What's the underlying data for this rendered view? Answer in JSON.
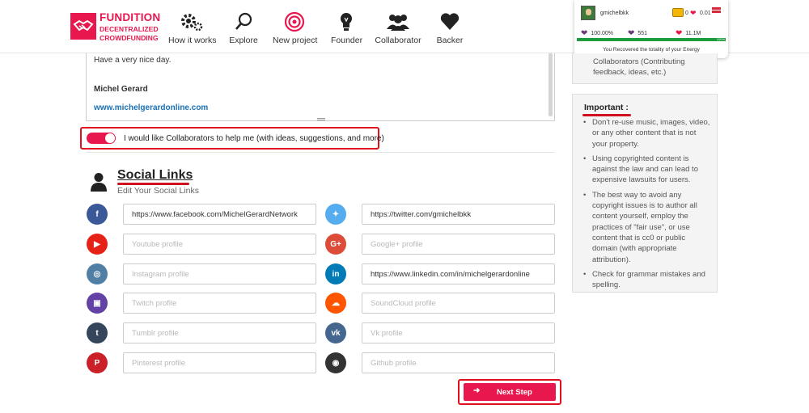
{
  "brand": {
    "name": "FUNDITION",
    "tagline_line1": "DECENTRALIZED",
    "tagline_line2": "CROWDFUNDING",
    "color": "#e8184e"
  },
  "nav": [
    {
      "label": "How it works",
      "icon": "gears-icon"
    },
    {
      "label": "Explore",
      "icon": "search-icon"
    },
    {
      "label": "New project",
      "icon": "target-icon"
    },
    {
      "label": "Founder",
      "icon": "lightbulb-icon"
    },
    {
      "label": "Collaborator",
      "icon": "group-icon"
    },
    {
      "label": "Backer",
      "icon": "heart-icon"
    }
  ],
  "user": {
    "username": "gmichelbkk",
    "chest_count": "0",
    "rate": "0.01",
    "voting_power": "100.00%",
    "reputation": "551",
    "balance": "11.1M",
    "progress": 1.0,
    "progress_label": "100%",
    "message": "You Recovered the totality of your Energy"
  },
  "signature": {
    "greeting": "Have a very nice day.",
    "name": "Michel Gerard",
    "link": "www.michelgerardonline.com"
  },
  "collab_toggle": {
    "on": true,
    "label": "I would like Collaborators to help me (with ideas, suggestions, and more)"
  },
  "social": {
    "title": "Social Links",
    "subtitle": "Edit Your Social Links",
    "left": [
      {
        "network": "facebook",
        "icon": "facebook-icon",
        "glyph": "f",
        "color": "#3b5998",
        "value": "https://www.facebook.com/MichelGerardNetwork",
        "placeholder": "Facebook profile"
      },
      {
        "network": "youtube",
        "icon": "youtube-icon",
        "glyph": "▶",
        "color": "#e62117",
        "value": "",
        "placeholder": "Youtube profile"
      },
      {
        "network": "instagram",
        "icon": "instagram-icon",
        "glyph": "◎",
        "color": "#517fa4",
        "value": "",
        "placeholder": "Instagram profile"
      },
      {
        "network": "twitch",
        "icon": "twitch-icon",
        "glyph": "▣",
        "color": "#6441a5",
        "value": "",
        "placeholder": "Twitch profile"
      },
      {
        "network": "tumblr",
        "icon": "tumblr-icon",
        "glyph": "t",
        "color": "#35465c",
        "value": "",
        "placeholder": "Tumblr profile"
      },
      {
        "network": "pinterest",
        "icon": "pinterest-icon",
        "glyph": "P",
        "color": "#cb2027",
        "value": "",
        "placeholder": "Pinterest profile"
      }
    ],
    "right": [
      {
        "network": "twitter",
        "icon": "twitter-icon",
        "glyph": "✦",
        "color": "#55acee",
        "value": "https://twitter.com/gmichelbkk",
        "placeholder": "Twitter profile"
      },
      {
        "network": "googleplus",
        "icon": "google-plus-icon",
        "glyph": "G+",
        "color": "#dd4b39",
        "value": "",
        "placeholder": "Google+ profile"
      },
      {
        "network": "linkedin",
        "icon": "linkedin-icon",
        "glyph": "in",
        "color": "#007bb5",
        "value": "https://www.linkedin.com/in/michelgerardonline",
        "placeholder": "LinkedIn profile"
      },
      {
        "network": "soundcloud",
        "icon": "soundcloud-icon",
        "glyph": "☁",
        "color": "#ff5500",
        "value": "",
        "placeholder": "SoundCloud profile"
      },
      {
        "network": "vk",
        "icon": "vk-icon",
        "glyph": "vk",
        "color": "#45668e",
        "value": "",
        "placeholder": "Vk profile"
      },
      {
        "network": "github",
        "icon": "github-icon",
        "glyph": "◉",
        "color": "#333333",
        "value": "",
        "placeholder": "Github profile"
      }
    ]
  },
  "next_button": {
    "label": "Next Step"
  },
  "sidebar": {
    "collaborators_note": "Collaborators (Contributing feedback, ideas, etc.)",
    "important_title": "Important :",
    "important_items": [
      "Don't re-use music, images, video, or any other content that is not your property.",
      "Using copyrighted content is against the law and can lead to expensive lawsuits for users.",
      "The best way to avoid any copyright issues is to author all content yourself, employ the practices of \"fair use\", or use content that is cc0 or public domain (with appropriate attribution).",
      "Check for grammar mistakes and spelling."
    ]
  }
}
